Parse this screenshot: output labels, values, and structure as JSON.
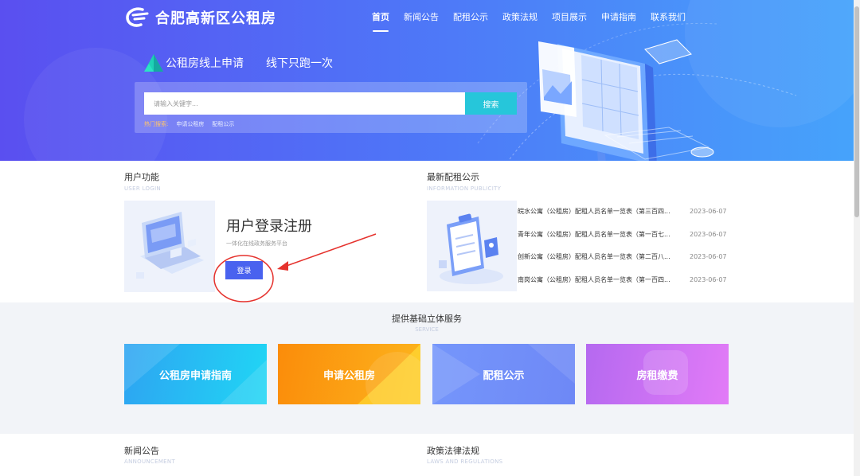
{
  "header": {
    "logo_text": "合肥高新区公租房",
    "nav": [
      {
        "label": "首页",
        "active": true
      },
      {
        "label": "新闻公告"
      },
      {
        "label": "配租公示"
      },
      {
        "label": "政策法规"
      },
      {
        "label": "项目展示"
      },
      {
        "label": "申请指南"
      },
      {
        "label": "联系我们"
      }
    ]
  },
  "hero": {
    "slogan_1": "公租房线上申请",
    "slogan_2": "线下只跑一次"
  },
  "search": {
    "placeholder": "请输入关键字...",
    "button": "搜索",
    "hot_label": "热门搜索:",
    "hot_links": [
      "申请公租房",
      "配租公示"
    ]
  },
  "user_section": {
    "title": "用户功能",
    "subtitle": "USER LOGIN",
    "card_title": "用户登录注册",
    "card_desc": "一体化在线政务服务平台",
    "login_button": "登录"
  },
  "notice_section": {
    "title": "最新配租公示",
    "subtitle": "INFORMATION PUBLICITY",
    "items": [
      {
        "text": "皖水公寓（公租房）配租人员名单一览表（第三百四...",
        "date": "2023-06-07"
      },
      {
        "text": "青年公寓（公租房）配租人员名单一览表（第一百七...",
        "date": "2023-06-07"
      },
      {
        "text": "创新公寓（公租房）配租人员名单一览表（第二百八...",
        "date": "2023-06-07"
      },
      {
        "text": "南岗公寓（公租房）配租人员名单一览表（第一百四...",
        "date": "2023-06-07"
      }
    ]
  },
  "service": {
    "title": "提供基础立体服务",
    "subtitle": "SERVICE",
    "cards": [
      "公租房申请指南",
      "申请公租房",
      "配租公示",
      "房租缴费"
    ]
  },
  "bottom": {
    "news_title": "新闻公告",
    "news_subtitle": "ANNOUNCEMENT",
    "policy_title": "政策法律法规",
    "policy_subtitle": "LAWS AND REGULATIONS"
  },
  "colors": {
    "brand_blue": "#4962ef",
    "search_button": "#26c6da",
    "annotation_red": "#e5322d"
  }
}
